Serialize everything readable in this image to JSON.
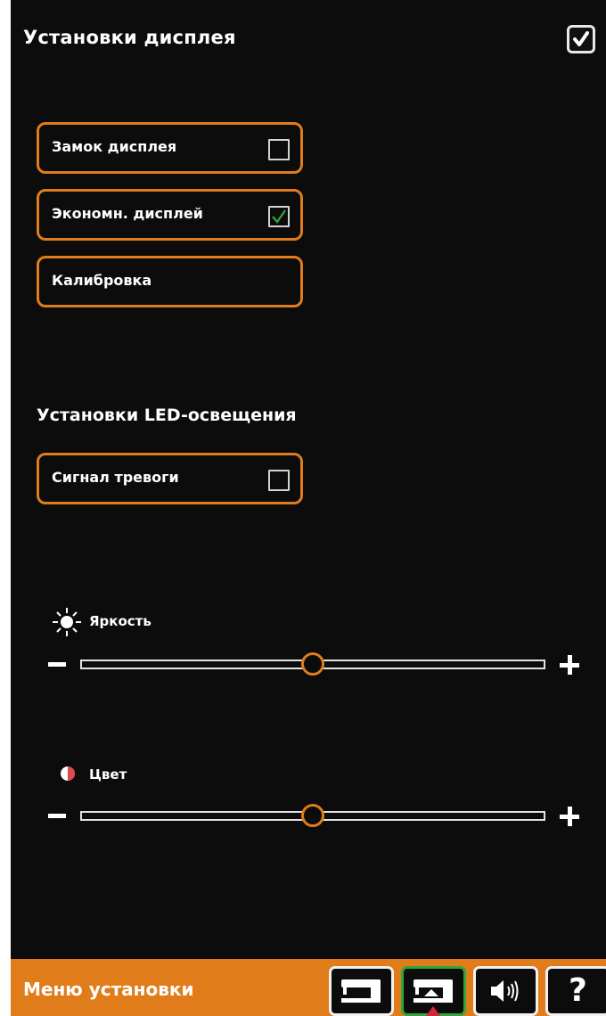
{
  "header": {
    "title": "Установки дисплея"
  },
  "display_options": [
    {
      "label": "Замок дисплея",
      "checked": false
    },
    {
      "label": "Экономн. дисплей",
      "checked": true
    },
    {
      "label": "Калибровка"
    }
  ],
  "led_section": {
    "title": "Установки LED-освещения",
    "alarm": {
      "label": "Сигнал тревоги",
      "checked": false
    }
  },
  "sliders": {
    "brightness": {
      "label": "Яркость",
      "value_fraction": 0.5,
      "icon": "sun-icon"
    },
    "color": {
      "label": "Цвет",
      "value_fraction": 0.5,
      "icon": "half-circle-icon"
    }
  },
  "footer": {
    "title": "Меню установки",
    "tabs": [
      {
        "icon": "sewing-machine-icon",
        "active": false
      },
      {
        "icon": "sewing-machine-settings-icon",
        "active": true
      },
      {
        "icon": "speaker-icon",
        "active": false
      },
      {
        "icon": "help-icon",
        "label": "?",
        "active": false
      }
    ]
  },
  "colors": {
    "accent": "#e07d1a",
    "background": "#0c0c0c",
    "check": "#31a53c"
  }
}
